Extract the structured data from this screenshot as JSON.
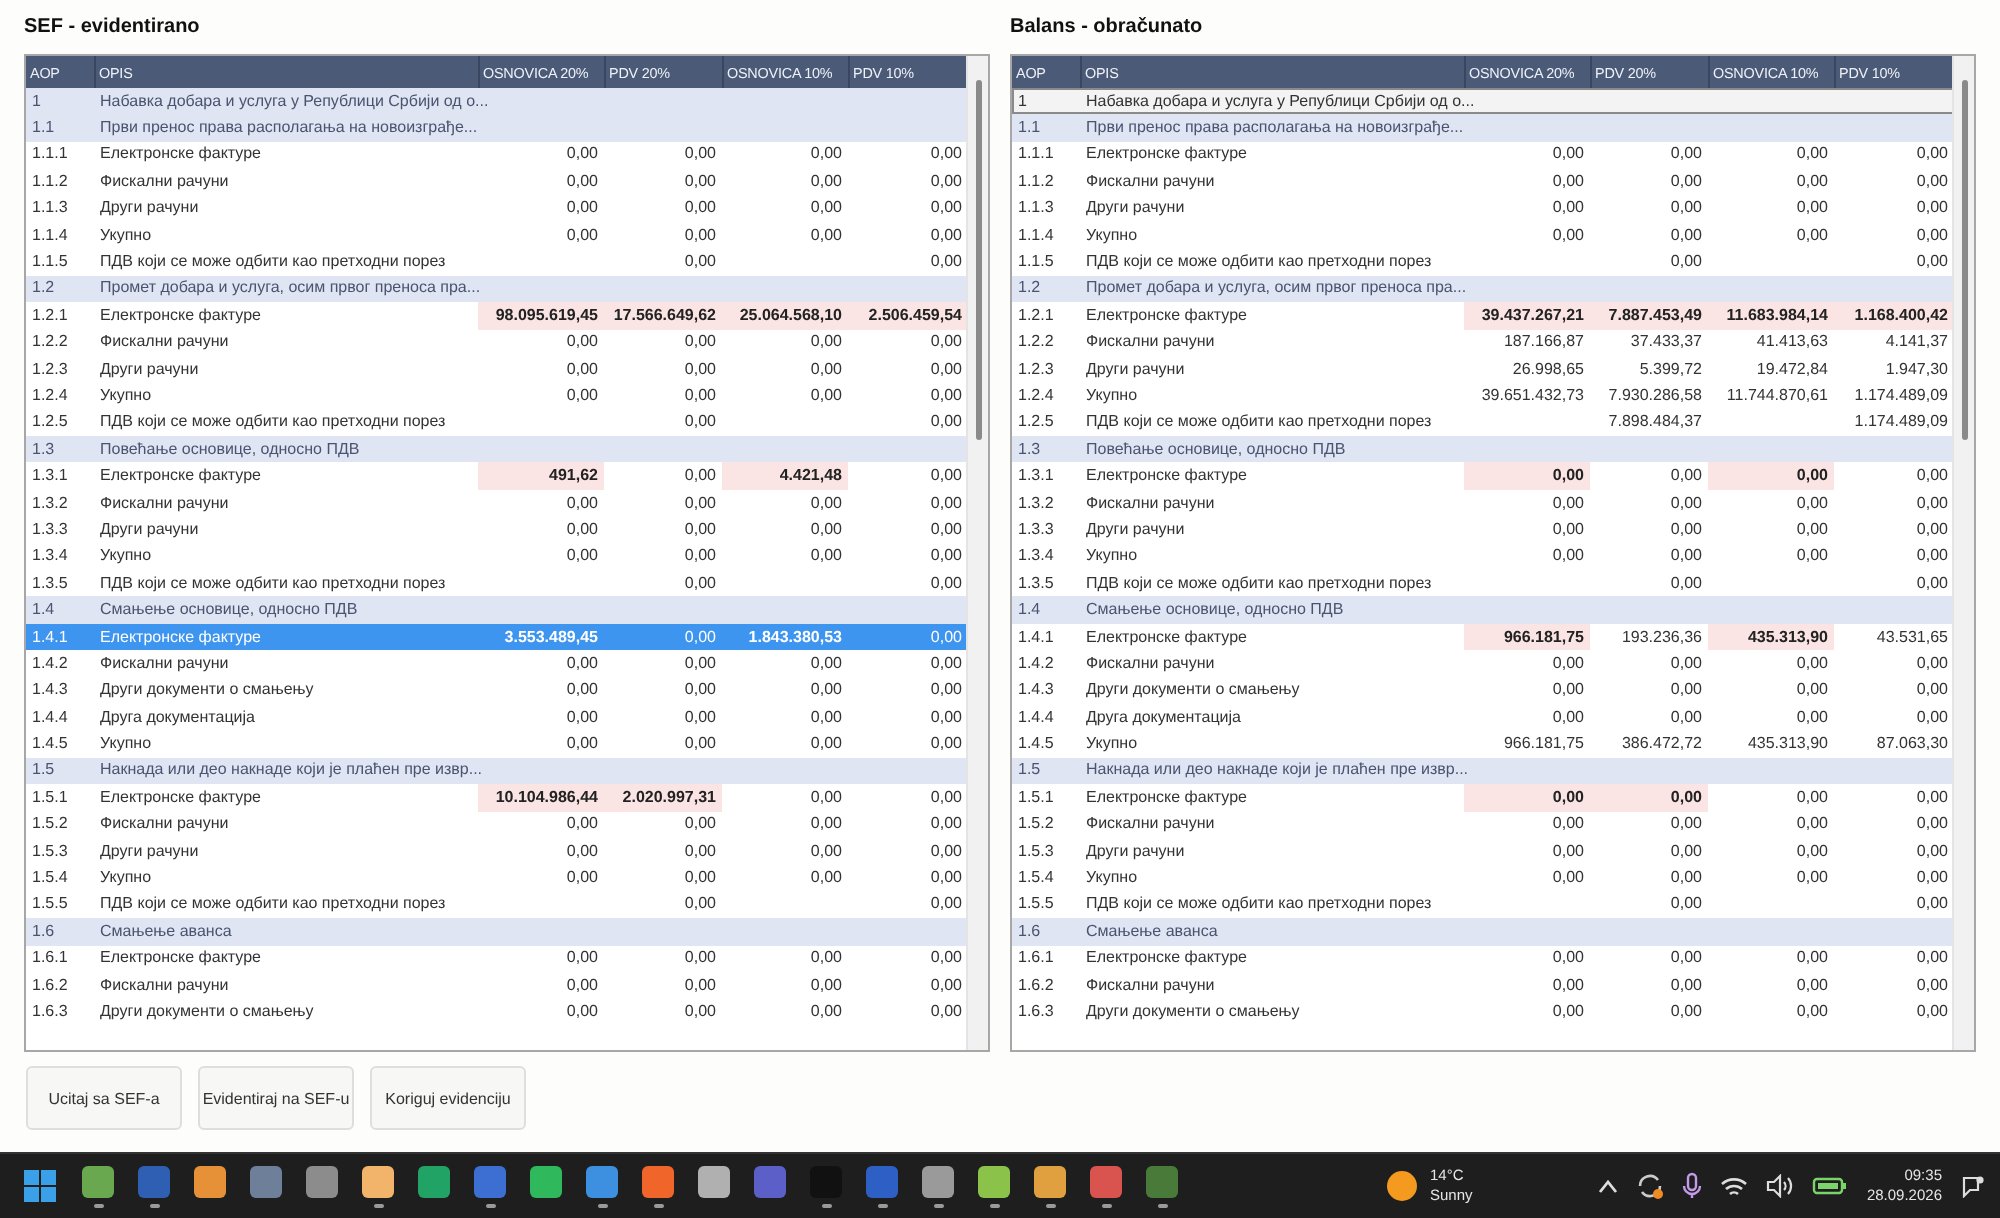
{
  "tables": [
    {
      "title": "SEF - evidentirano",
      "columns": [
        "AOP",
        "OPIS",
        "OSNOVICA 20%",
        "PDV 20%",
        "OSNOVICA 10%",
        "PDV 10%"
      ],
      "rows": [
        {
          "aop": "1",
          "opis": "Набавка добара и услуга у Републици Србији од о...",
          "kind": "group",
          "selected": false,
          "focused": false
        },
        {
          "aop": "1.1",
          "opis": "Први пренос права располагања на новоизграђе...",
          "kind": "group",
          "selected": false,
          "focused": false
        },
        {
          "aop": "1.1.1",
          "opis": "Електронске фактуре",
          "kind": "item",
          "selected": false,
          "focused": false,
          "cells": [
            {
              "value": "0,00",
              "flagged": false
            },
            {
              "value": "0,00",
              "flagged": false
            },
            {
              "value": "0,00",
              "flagged": false
            },
            {
              "value": "0,00",
              "flagged": false
            }
          ]
        },
        {
          "aop": "1.1.2",
          "opis": "Фискални рачуни",
          "kind": "item",
          "selected": false,
          "focused": false,
          "cells": [
            {
              "value": "0,00",
              "flagged": false
            },
            {
              "value": "0,00",
              "flagged": false
            },
            {
              "value": "0,00",
              "flagged": false
            },
            {
              "value": "0,00",
              "flagged": false
            }
          ]
        },
        {
          "aop": "1.1.3",
          "opis": "Други рачуни",
          "kind": "item",
          "selected": false,
          "focused": false,
          "cells": [
            {
              "value": "0,00",
              "flagged": false
            },
            {
              "value": "0,00",
              "flagged": false
            },
            {
              "value": "0,00",
              "flagged": false
            },
            {
              "value": "0,00",
              "flagged": false
            }
          ]
        },
        {
          "aop": "1.1.4",
          "opis": "Укупно",
          "kind": "item",
          "selected": false,
          "focused": false,
          "cells": [
            {
              "value": "0,00",
              "flagged": false
            },
            {
              "value": "0,00",
              "flagged": false
            },
            {
              "value": "0,00",
              "flagged": false
            },
            {
              "value": "0,00",
              "flagged": false
            }
          ]
        },
        {
          "aop": "1.1.5",
          "opis": "ПДВ који се може одбити као претходни порез",
          "kind": "item",
          "selected": false,
          "focused": false,
          "cells": [
            null,
            {
              "value": "0,00",
              "flagged": false
            },
            null,
            {
              "value": "0,00",
              "flagged": false
            }
          ]
        },
        {
          "aop": "1.2",
          "opis": "Промет добара и услуга, осим првог преноса пра...",
          "kind": "group",
          "selected": false,
          "focused": false
        },
        {
          "aop": "1.2.1",
          "opis": "Електронске фактуре",
          "kind": "item",
          "selected": false,
          "focused": false,
          "cells": [
            {
              "value": "98.095.619,45",
              "flagged": true
            },
            {
              "value": "17.566.649,62",
              "flagged": true
            },
            {
              "value": "25.064.568,10",
              "flagged": true
            },
            {
              "value": "2.506.459,54",
              "flagged": true
            }
          ]
        },
        {
          "aop": "1.2.2",
          "opis": "Фискални рачуни",
          "kind": "item",
          "selected": false,
          "focused": false,
          "cells": [
            {
              "value": "0,00",
              "flagged": false
            },
            {
              "value": "0,00",
              "flagged": false
            },
            {
              "value": "0,00",
              "flagged": false
            },
            {
              "value": "0,00",
              "flagged": false
            }
          ]
        },
        {
          "aop": "1.2.3",
          "opis": "Други рачуни",
          "kind": "item",
          "selected": false,
          "focused": false,
          "cells": [
            {
              "value": "0,00",
              "flagged": false
            },
            {
              "value": "0,00",
              "flagged": false
            },
            {
              "value": "0,00",
              "flagged": false
            },
            {
              "value": "0,00",
              "flagged": false
            }
          ]
        },
        {
          "aop": "1.2.4",
          "opis": "Укупно",
          "kind": "item",
          "selected": false,
          "focused": false,
          "cells": [
            {
              "value": "0,00",
              "flagged": false
            },
            {
              "value": "0,00",
              "flagged": false
            },
            {
              "value": "0,00",
              "flagged": false
            },
            {
              "value": "0,00",
              "flagged": false
            }
          ]
        },
        {
          "aop": "1.2.5",
          "opis": "ПДВ који се може одбити као претходни порез",
          "kind": "item",
          "selected": false,
          "focused": false,
          "cells": [
            null,
            {
              "value": "0,00",
              "flagged": false
            },
            null,
            {
              "value": "0,00",
              "flagged": false
            }
          ]
        },
        {
          "aop": "1.3",
          "opis": "Повећање основице, односно ПДВ",
          "kind": "group",
          "selected": false,
          "focused": false
        },
        {
          "aop": "1.3.1",
          "opis": "Електронске фактуре",
          "kind": "item",
          "selected": false,
          "focused": false,
          "cells": [
            {
              "value": "491,62",
              "flagged": true
            },
            {
              "value": "0,00",
              "flagged": false
            },
            {
              "value": "4.421,48",
              "flagged": true
            },
            {
              "value": "0,00",
              "flagged": false
            }
          ]
        },
        {
          "aop": "1.3.2",
          "opis": "Фискални рачуни",
          "kind": "item",
          "selected": false,
          "focused": false,
          "cells": [
            {
              "value": "0,00",
              "flagged": false
            },
            {
              "value": "0,00",
              "flagged": false
            },
            {
              "value": "0,00",
              "flagged": false
            },
            {
              "value": "0,00",
              "flagged": false
            }
          ]
        },
        {
          "aop": "1.3.3",
          "opis": "Други рачуни",
          "kind": "item",
          "selected": false,
          "focused": false,
          "cells": [
            {
              "value": "0,00",
              "flagged": false
            },
            {
              "value": "0,00",
              "flagged": false
            },
            {
              "value": "0,00",
              "flagged": false
            },
            {
              "value": "0,00",
              "flagged": false
            }
          ]
        },
        {
          "aop": "1.3.4",
          "opis": "Укупно",
          "kind": "item",
          "selected": false,
          "focused": false,
          "cells": [
            {
              "value": "0,00",
              "flagged": false
            },
            {
              "value": "0,00",
              "flagged": false
            },
            {
              "value": "0,00",
              "flagged": false
            },
            {
              "value": "0,00",
              "flagged": false
            }
          ]
        },
        {
          "aop": "1.3.5",
          "opis": "ПДВ који се може одбити као претходни порез",
          "kind": "item",
          "selected": false,
          "focused": false,
          "cells": [
            null,
            {
              "value": "0,00",
              "flagged": false
            },
            null,
            {
              "value": "0,00",
              "flagged": false
            }
          ]
        },
        {
          "aop": "1.4",
          "opis": "Смањење основице, односно ПДВ",
          "kind": "group",
          "selected": false,
          "focused": false
        },
        {
          "aop": "1.4.1",
          "opis": "Електронске фактуре",
          "kind": "item",
          "selected": true,
          "focused": false,
          "cells": [
            {
              "value": "3.553.489,45",
              "flagged": true
            },
            {
              "value": "0,00",
              "flagged": false
            },
            {
              "value": "1.843.380,53",
              "flagged": true
            },
            {
              "value": "0,00",
              "flagged": false
            }
          ]
        },
        {
          "aop": "1.4.2",
          "opis": "Фискални рачуни",
          "kind": "item",
          "selected": false,
          "focused": false,
          "cells": [
            {
              "value": "0,00",
              "flagged": false
            },
            {
              "value": "0,00",
              "flagged": false
            },
            {
              "value": "0,00",
              "flagged": false
            },
            {
              "value": "0,00",
              "flagged": false
            }
          ]
        },
        {
          "aop": "1.4.3",
          "opis": "Други документи о смањењу",
          "kind": "item",
          "selected": false,
          "focused": false,
          "cells": [
            {
              "value": "0,00",
              "flagged": false
            },
            {
              "value": "0,00",
              "flagged": false
            },
            {
              "value": "0,00",
              "flagged": false
            },
            {
              "value": "0,00",
              "flagged": false
            }
          ]
        },
        {
          "aop": "1.4.4",
          "opis": "Друга документација",
          "kind": "item",
          "selected": false,
          "focused": false,
          "cells": [
            {
              "value": "0,00",
              "flagged": false
            },
            {
              "value": "0,00",
              "flagged": false
            },
            {
              "value": "0,00",
              "flagged": false
            },
            {
              "value": "0,00",
              "flagged": false
            }
          ]
        },
        {
          "aop": "1.4.5",
          "opis": "Укупно",
          "kind": "item",
          "selected": false,
          "focused": false,
          "cells": [
            {
              "value": "0,00",
              "flagged": false
            },
            {
              "value": "0,00",
              "flagged": false
            },
            {
              "value": "0,00",
              "flagged": false
            },
            {
              "value": "0,00",
              "flagged": false
            }
          ]
        },
        {
          "aop": "1.5",
          "opis": "Накнада или део накнаде који је плаћен пре извр...",
          "kind": "group",
          "selected": false,
          "focused": false
        },
        {
          "aop": "1.5.1",
          "opis": "Електронске фактуре",
          "kind": "item",
          "selected": false,
          "focused": false,
          "cells": [
            {
              "value": "10.104.986,44",
              "flagged": true
            },
            {
              "value": "2.020.997,31",
              "flagged": true
            },
            {
              "value": "0,00",
              "flagged": false
            },
            {
              "value": "0,00",
              "flagged": false
            }
          ]
        },
        {
          "aop": "1.5.2",
          "opis": "Фискални рачуни",
          "kind": "item",
          "selected": false,
          "focused": false,
          "cells": [
            {
              "value": "0,00",
              "flagged": false
            },
            {
              "value": "0,00",
              "flagged": false
            },
            {
              "value": "0,00",
              "flagged": false
            },
            {
              "value": "0,00",
              "flagged": false
            }
          ]
        },
        {
          "aop": "1.5.3",
          "opis": "Други рачуни",
          "kind": "item",
          "selected": false,
          "focused": false,
          "cells": [
            {
              "value": "0,00",
              "flagged": false
            },
            {
              "value": "0,00",
              "flagged": false
            },
            {
              "value": "0,00",
              "flagged": false
            },
            {
              "value": "0,00",
              "flagged": false
            }
          ]
        },
        {
          "aop": "1.5.4",
          "opis": "Укупно",
          "kind": "item",
          "selected": false,
          "focused": false,
          "cells": [
            {
              "value": "0,00",
              "flagged": false
            },
            {
              "value": "0,00",
              "flagged": false
            },
            {
              "value": "0,00",
              "flagged": false
            },
            {
              "value": "0,00",
              "flagged": false
            }
          ]
        },
        {
          "aop": "1.5.5",
          "opis": "ПДВ који се може одбити као претходни порез",
          "kind": "item",
          "selected": false,
          "focused": false,
          "cells": [
            null,
            {
              "value": "0,00",
              "flagged": false
            },
            null,
            {
              "value": "0,00",
              "flagged": false
            }
          ]
        },
        {
          "aop": "1.6",
          "opis": "Смањење аванса",
          "kind": "group",
          "selected": false,
          "focused": false
        },
        {
          "aop": "1.6.1",
          "opis": "Електронске фактуре",
          "kind": "item",
          "selected": false,
          "focused": false,
          "cells": [
            {
              "value": "0,00",
              "flagged": false
            },
            {
              "value": "0,00",
              "flagged": false
            },
            {
              "value": "0,00",
              "flagged": false
            },
            {
              "value": "0,00",
              "flagged": false
            }
          ]
        },
        {
          "aop": "1.6.2",
          "opis": "Фискални рачуни",
          "kind": "item",
          "selected": false,
          "focused": false,
          "cells": [
            {
              "value": "0,00",
              "flagged": false
            },
            {
              "value": "0,00",
              "flagged": false
            },
            {
              "value": "0,00",
              "flagged": false
            },
            {
              "value": "0,00",
              "flagged": false
            }
          ]
        },
        {
          "aop": "1.6.3",
          "opis": "Други документи о смањењу",
          "kind": "item",
          "selected": false,
          "focused": false,
          "cells": [
            {
              "value": "0,00",
              "flagged": false
            },
            {
              "value": "0,00",
              "flagged": false
            },
            {
              "value": "0,00",
              "flagged": false
            },
            {
              "value": "0,00",
              "flagged": false
            }
          ]
        }
      ]
    },
    {
      "title": "Balans - obračunato",
      "columns": [
        "AOP",
        "OPIS",
        "OSNOVICA 20%",
        "PDV 20%",
        "OSNOVICA 10%",
        "PDV 10%"
      ],
      "rows": [
        {
          "aop": "1",
          "opis": "Набавка добара и услуга у Републици Србији од о...",
          "kind": "group",
          "selected": false,
          "focused": true
        },
        {
          "aop": "1.1",
          "opis": "Први пренос права располагања на новоизграђе...",
          "kind": "group",
          "selected": false,
          "focused": false
        },
        {
          "aop": "1.1.1",
          "opis": "Електронске фактуре",
          "kind": "item",
          "selected": false,
          "focused": false,
          "cells": [
            {
              "value": "0,00",
              "flagged": false
            },
            {
              "value": "0,00",
              "flagged": false
            },
            {
              "value": "0,00",
              "flagged": false
            },
            {
              "value": "0,00",
              "flagged": false
            }
          ]
        },
        {
          "aop": "1.1.2",
          "opis": "Фискални рачуни",
          "kind": "item",
          "selected": false,
          "focused": false,
          "cells": [
            {
              "value": "0,00",
              "flagged": false
            },
            {
              "value": "0,00",
              "flagged": false
            },
            {
              "value": "0,00",
              "flagged": false
            },
            {
              "value": "0,00",
              "flagged": false
            }
          ]
        },
        {
          "aop": "1.1.3",
          "opis": "Други рачуни",
          "kind": "item",
          "selected": false,
          "focused": false,
          "cells": [
            {
              "value": "0,00",
              "flagged": false
            },
            {
              "value": "0,00",
              "flagged": false
            },
            {
              "value": "0,00",
              "flagged": false
            },
            {
              "value": "0,00",
              "flagged": false
            }
          ]
        },
        {
          "aop": "1.1.4",
          "opis": "Укупно",
          "kind": "item",
          "selected": false,
          "focused": false,
          "cells": [
            {
              "value": "0,00",
              "flagged": false
            },
            {
              "value": "0,00",
              "flagged": false
            },
            {
              "value": "0,00",
              "flagged": false
            },
            {
              "value": "0,00",
              "flagged": false
            }
          ]
        },
        {
          "aop": "1.1.5",
          "opis": "ПДВ који се може одбити као претходни порез",
          "kind": "item",
          "selected": false,
          "focused": false,
          "cells": [
            null,
            {
              "value": "0,00",
              "flagged": false
            },
            null,
            {
              "value": "0,00",
              "flagged": false
            }
          ]
        },
        {
          "aop": "1.2",
          "opis": "Промет добара и услуга, осим првог преноса пра...",
          "kind": "group",
          "selected": false,
          "focused": false
        },
        {
          "aop": "1.2.1",
          "opis": "Електронске фактуре",
          "kind": "item",
          "selected": false,
          "focused": false,
          "cells": [
            {
              "value": "39.437.267,21",
              "flagged": true
            },
            {
              "value": "7.887.453,49",
              "flagged": true
            },
            {
              "value": "11.683.984,14",
              "flagged": true
            },
            {
              "value": "1.168.400,42",
              "flagged": true
            }
          ]
        },
        {
          "aop": "1.2.2",
          "opis": "Фискални рачуни",
          "kind": "item",
          "selected": false,
          "focused": false,
          "cells": [
            {
              "value": "187.166,87",
              "flagged": false
            },
            {
              "value": "37.433,37",
              "flagged": false
            },
            {
              "value": "41.413,63",
              "flagged": false
            },
            {
              "value": "4.141,37",
              "flagged": false
            }
          ]
        },
        {
          "aop": "1.2.3",
          "opis": "Други рачуни",
          "kind": "item",
          "selected": false,
          "focused": false,
          "cells": [
            {
              "value": "26.998,65",
              "flagged": false
            },
            {
              "value": "5.399,72",
              "flagged": false
            },
            {
              "value": "19.472,84",
              "flagged": false
            },
            {
              "value": "1.947,30",
              "flagged": false
            }
          ]
        },
        {
          "aop": "1.2.4",
          "opis": "Укупно",
          "kind": "item",
          "selected": false,
          "focused": false,
          "cells": [
            {
              "value": "39.651.432,73",
              "flagged": false
            },
            {
              "value": "7.930.286,58",
              "flagged": false
            },
            {
              "value": "11.744.870,61",
              "flagged": false
            },
            {
              "value": "1.174.489,09",
              "flagged": false
            }
          ]
        },
        {
          "aop": "1.2.5",
          "opis": "ПДВ који се може одбити као претходни порез",
          "kind": "item",
          "selected": false,
          "focused": false,
          "cells": [
            null,
            {
              "value": "7.898.484,37",
              "flagged": false
            },
            null,
            {
              "value": "1.174.489,09",
              "flagged": false
            }
          ]
        },
        {
          "aop": "1.3",
          "opis": "Повећање основице, односно ПДВ",
          "kind": "group",
          "selected": false,
          "focused": false
        },
        {
          "aop": "1.3.1",
          "opis": "Електронске фактуре",
          "kind": "item",
          "selected": false,
          "focused": false,
          "cells": [
            {
              "value": "0,00",
              "flagged": true
            },
            {
              "value": "0,00",
              "flagged": false
            },
            {
              "value": "0,00",
              "flagged": true
            },
            {
              "value": "0,00",
              "flagged": false
            }
          ]
        },
        {
          "aop": "1.3.2",
          "opis": "Фискални рачуни",
          "kind": "item",
          "selected": false,
          "focused": false,
          "cells": [
            {
              "value": "0,00",
              "flagged": false
            },
            {
              "value": "0,00",
              "flagged": false
            },
            {
              "value": "0,00",
              "flagged": false
            },
            {
              "value": "0,00",
              "flagged": false
            }
          ]
        },
        {
          "aop": "1.3.3",
          "opis": "Други рачуни",
          "kind": "item",
          "selected": false,
          "focused": false,
          "cells": [
            {
              "value": "0,00",
              "flagged": false
            },
            {
              "value": "0,00",
              "flagged": false
            },
            {
              "value": "0,00",
              "flagged": false
            },
            {
              "value": "0,00",
              "flagged": false
            }
          ]
        },
        {
          "aop": "1.3.4",
          "opis": "Укупно",
          "kind": "item",
          "selected": false,
          "focused": false,
          "cells": [
            {
              "value": "0,00",
              "flagged": false
            },
            {
              "value": "0,00",
              "flagged": false
            },
            {
              "value": "0,00",
              "flagged": false
            },
            {
              "value": "0,00",
              "flagged": false
            }
          ]
        },
        {
          "aop": "1.3.5",
          "opis": "ПДВ који се може одбити као претходни порез",
          "kind": "item",
          "selected": false,
          "focused": false,
          "cells": [
            null,
            {
              "value": "0,00",
              "flagged": false
            },
            null,
            {
              "value": "0,00",
              "flagged": false
            }
          ]
        },
        {
          "aop": "1.4",
          "opis": "Смањење основице, односно ПДВ",
          "kind": "group",
          "selected": false,
          "focused": false
        },
        {
          "aop": "1.4.1",
          "opis": "Електронске фактуре",
          "kind": "item",
          "selected": false,
          "focused": false,
          "cells": [
            {
              "value": "966.181,75",
              "flagged": true
            },
            {
              "value": "193.236,36",
              "flagged": false
            },
            {
              "value": "435.313,90",
              "flagged": true
            },
            {
              "value": "43.531,65",
              "flagged": false
            }
          ]
        },
        {
          "aop": "1.4.2",
          "opis": "Фискални рачуни",
          "kind": "item",
          "selected": false,
          "focused": false,
          "cells": [
            {
              "value": "0,00",
              "flagged": false
            },
            {
              "value": "0,00",
              "flagged": false
            },
            {
              "value": "0,00",
              "flagged": false
            },
            {
              "value": "0,00",
              "flagged": false
            }
          ]
        },
        {
          "aop": "1.4.3",
          "opis": "Други документи о смањењу",
          "kind": "item",
          "selected": false,
          "focused": false,
          "cells": [
            {
              "value": "0,00",
              "flagged": false
            },
            {
              "value": "0,00",
              "flagged": false
            },
            {
              "value": "0,00",
              "flagged": false
            },
            {
              "value": "0,00",
              "flagged": false
            }
          ]
        },
        {
          "aop": "1.4.4",
          "opis": "Друга документација",
          "kind": "item",
          "selected": false,
          "focused": false,
          "cells": [
            {
              "value": "0,00",
              "flagged": false
            },
            {
              "value": "0,00",
              "flagged": false
            },
            {
              "value": "0,00",
              "flagged": false
            },
            {
              "value": "0,00",
              "flagged": false
            }
          ]
        },
        {
          "aop": "1.4.5",
          "opis": "Укупно",
          "kind": "item",
          "selected": false,
          "focused": false,
          "cells": [
            {
              "value": "966.181,75",
              "flagged": false
            },
            {
              "value": "386.472,72",
              "flagged": false
            },
            {
              "value": "435.313,90",
              "flagged": false
            },
            {
              "value": "87.063,30",
              "flagged": false
            }
          ]
        },
        {
          "aop": "1.5",
          "opis": "Накнада или део накнаде који је плаћен пре извр...",
          "kind": "group",
          "selected": false,
          "focused": false
        },
        {
          "aop": "1.5.1",
          "opis": "Електронске фактуре",
          "kind": "item",
          "selected": false,
          "focused": false,
          "cells": [
            {
              "value": "0,00",
              "flagged": true
            },
            {
              "value": "0,00",
              "flagged": true
            },
            {
              "value": "0,00",
              "flagged": false
            },
            {
              "value": "0,00",
              "flagged": false
            }
          ]
        },
        {
          "aop": "1.5.2",
          "opis": "Фискални рачуни",
          "kind": "item",
          "selected": false,
          "focused": false,
          "cells": [
            {
              "value": "0,00",
              "flagged": false
            },
            {
              "value": "0,00",
              "flagged": false
            },
            {
              "value": "0,00",
              "flagged": false
            },
            {
              "value": "0,00",
              "flagged": false
            }
          ]
        },
        {
          "aop": "1.5.3",
          "opis": "Други рачуни",
          "kind": "item",
          "selected": false,
          "focused": false,
          "cells": [
            {
              "value": "0,00",
              "flagged": false
            },
            {
              "value": "0,00",
              "flagged": false
            },
            {
              "value": "0,00",
              "flagged": false
            },
            {
              "value": "0,00",
              "flagged": false
            }
          ]
        },
        {
          "aop": "1.5.4",
          "opis": "Укупно",
          "kind": "item",
          "selected": false,
          "focused": false,
          "cells": [
            {
              "value": "0,00",
              "flagged": false
            },
            {
              "value": "0,00",
              "flagged": false
            },
            {
              "value": "0,00",
              "flagged": false
            },
            {
              "value": "0,00",
              "flagged": false
            }
          ]
        },
        {
          "aop": "1.5.5",
          "opis": "ПДВ који се може одбити као претходни порез",
          "kind": "item",
          "selected": false,
          "focused": false,
          "cells": [
            null,
            {
              "value": "0,00",
              "flagged": false
            },
            null,
            {
              "value": "0,00",
              "flagged": false
            }
          ]
        },
        {
          "aop": "1.6",
          "opis": "Смањење аванса",
          "kind": "group",
          "selected": false,
          "focused": false
        },
        {
          "aop": "1.6.1",
          "opis": "Електронске фактуре",
          "kind": "item",
          "selected": false,
          "focused": false,
          "cells": [
            {
              "value": "0,00",
              "flagged": false
            },
            {
              "value": "0,00",
              "flagged": false
            },
            {
              "value": "0,00",
              "flagged": false
            },
            {
              "value": "0,00",
              "flagged": false
            }
          ]
        },
        {
          "aop": "1.6.2",
          "opis": "Фискални рачуни",
          "kind": "item",
          "selected": false,
          "focused": false,
          "cells": [
            {
              "value": "0,00",
              "flagged": false
            },
            {
              "value": "0,00",
              "flagged": false
            },
            {
              "value": "0,00",
              "flagged": false
            },
            {
              "value": "0,00",
              "flagged": false
            }
          ]
        },
        {
          "aop": "1.6.3",
          "opis": "Други документи о смањењу",
          "kind": "item",
          "selected": false,
          "focused": false,
          "cells": [
            {
              "value": "0,00",
              "flagged": false
            },
            {
              "value": "0,00",
              "flagged": false
            },
            {
              "value": "0,00",
              "flagged": false
            },
            {
              "value": "0,00",
              "flagged": false
            }
          ]
        }
      ]
    }
  ],
  "buttons": [
    "Ucitaj sa SEF-a",
    "Evidentiraj na SEF-u",
    "Koriguj evidenciju"
  ],
  "taskbar": {
    "apps": [
      {
        "color": "#6aa84f",
        "running": true
      },
      {
        "color": "#2f5fb3",
        "running": true
      },
      {
        "color": "#e69138",
        "running": false
      },
      {
        "color": "#6d7f99",
        "running": false
      },
      {
        "color": "#8c8c8c",
        "running": false
      },
      {
        "color": "#f2b36b",
        "running": true
      },
      {
        "color": "#21a366",
        "running": false
      },
      {
        "color": "#3c6fd1",
        "running": true
      },
      {
        "color": "#2fb85c",
        "running": false
      },
      {
        "color": "#3d8fe0",
        "running": true
      },
      {
        "color": "#f0662a",
        "running": true
      },
      {
        "color": "#b0b0b0",
        "running": false
      },
      {
        "color": "#5b5fc7",
        "running": false
      },
      {
        "color": "#111111",
        "running": true
      },
      {
        "color": "#2d5fc4",
        "running": true
      },
      {
        "color": "#9a9a9a",
        "running": true
      },
      {
        "color": "#8bc34a",
        "running": true
      },
      {
        "color": "#e0a040",
        "running": true
      },
      {
        "color": "#d9534f",
        "running": true
      },
      {
        "color": "#4a7a3a",
        "running": true
      }
    ],
    "weather": {
      "temperature": "14°C",
      "condition": "Sunny"
    },
    "clock": {
      "time": "09:35",
      "date": "28.09.2026"
    }
  }
}
